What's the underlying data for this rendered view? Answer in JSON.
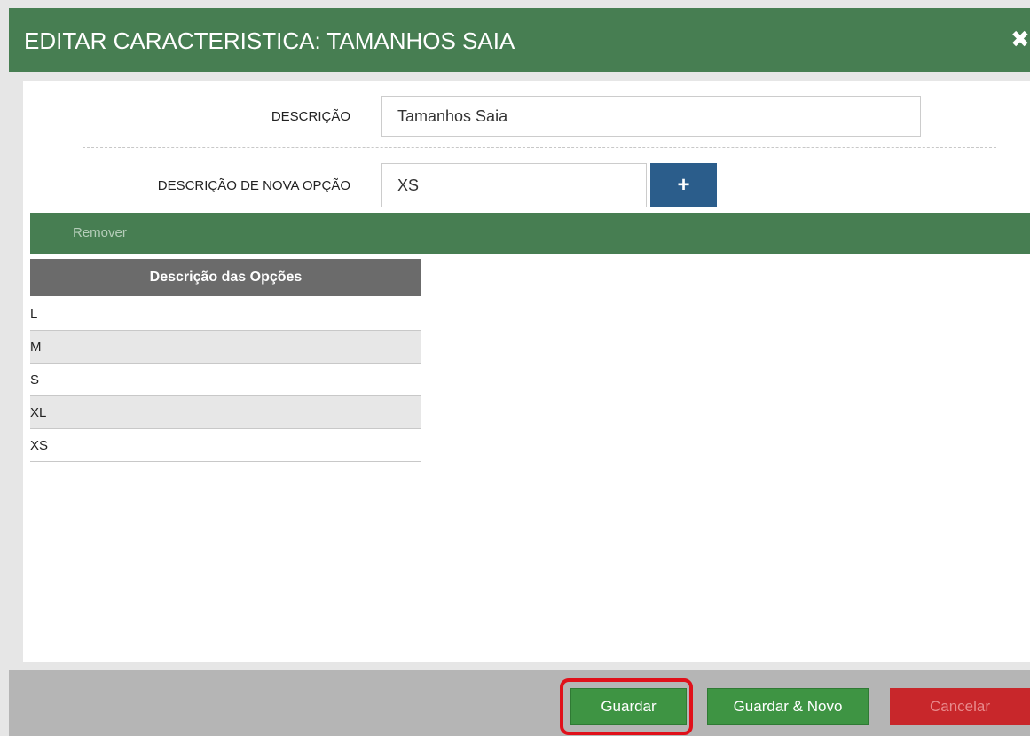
{
  "dialog": {
    "title": "EDITAR CARACTERISTICA: TAMANHOS SAIA",
    "close_icon": "close-icon"
  },
  "form": {
    "description_label": "DESCRIÇÃO",
    "description_value": "Tamanhos Saia",
    "new_option_label": "DESCRIÇÃO DE NOVA OPÇÃO",
    "new_option_value": "XS",
    "add_button_icon": "plus-icon",
    "add_button_glyph": "+"
  },
  "toolbar": {
    "remove_label": "Remover"
  },
  "options_table": {
    "header": "Descrição das Opções",
    "rows": [
      "L",
      "M",
      "S",
      "XL",
      "XS"
    ]
  },
  "footer": {
    "save_label": "Guardar",
    "save_new_label": "Guardar & Novo",
    "cancel_label": "Cancelar"
  },
  "colors": {
    "header_green": "#477e52",
    "button_green": "#3e9443",
    "add_blue": "#2b5d8b",
    "cancel_red": "#c8272b",
    "highlight_red": "#e0101a"
  }
}
